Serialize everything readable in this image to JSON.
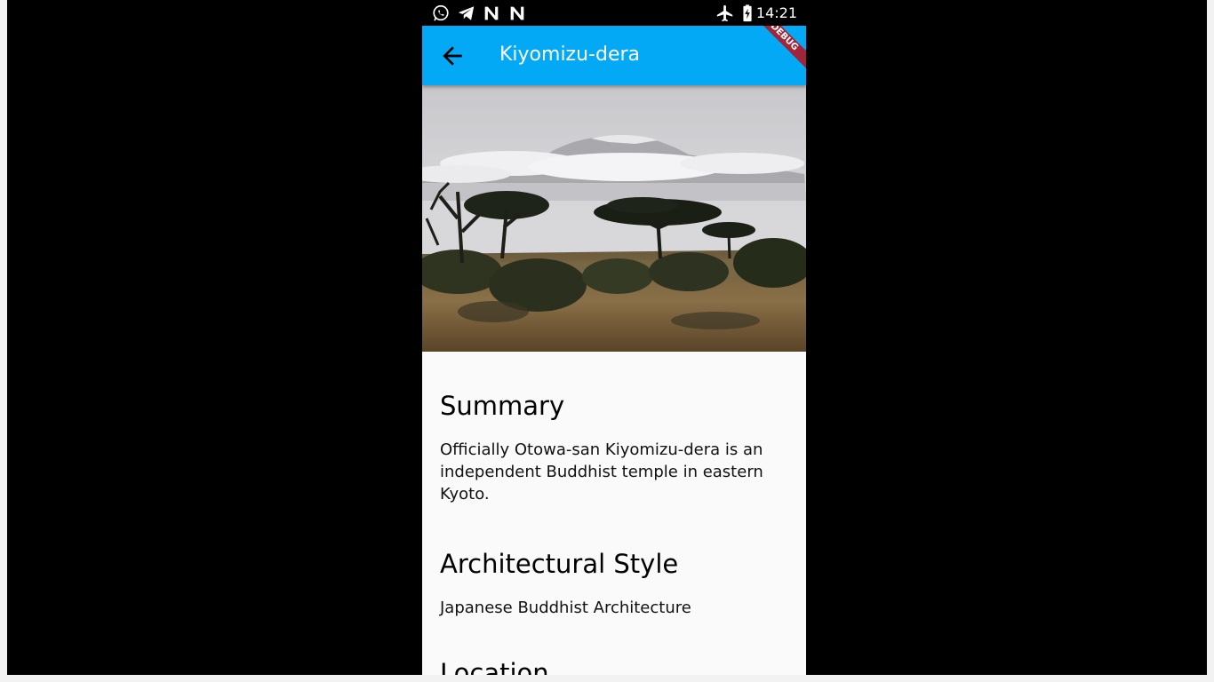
{
  "status_bar": {
    "time": "14:21",
    "left_icons": [
      "whatsapp-icon",
      "telegram-icon",
      "n-app-icon",
      "n-app-icon"
    ],
    "right_icons": [
      "airplane-mode-icon",
      "battery-charging-icon"
    ]
  },
  "app_bar": {
    "title": "Kiyomizu-dera",
    "back_icon": "arrow-back-icon",
    "color": "#03a9f4",
    "debug_banner": "DEBUG"
  },
  "hero_image": {
    "description_icon": "savanna-landscape-image"
  },
  "sections": [
    {
      "title": "Summary",
      "text": "Officially Otowa-san Kiyomizu-dera is an independent Buddhist temple in eastern Kyoto."
    },
    {
      "title": "Architectural Style",
      "text": "Japanese Buddhist Architecture"
    },
    {
      "title": "Location",
      "text": ""
    }
  ]
}
